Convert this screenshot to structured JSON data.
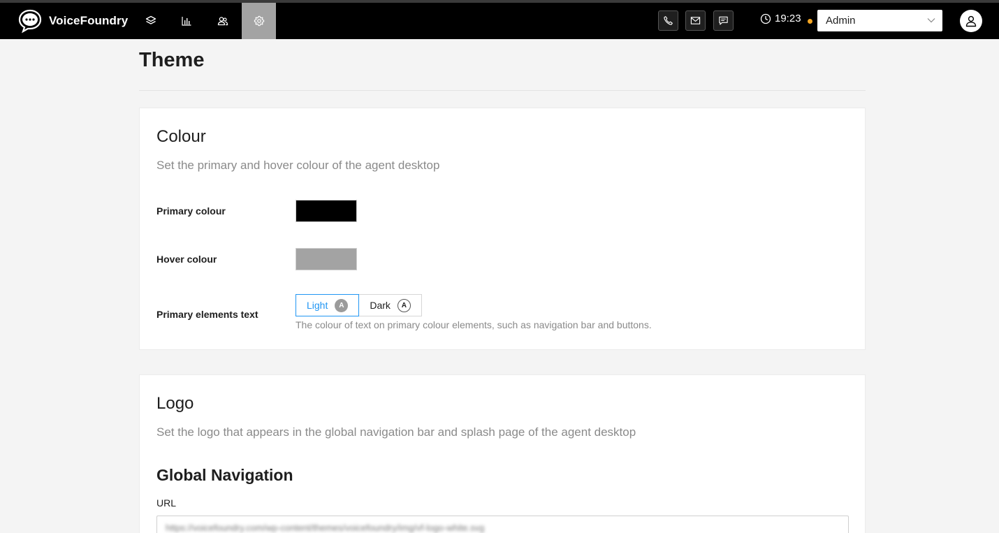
{
  "app": {
    "brand_name": "VoiceFoundry",
    "clock_time": "19:23",
    "user_select_value": "Admin",
    "status_color": "#f5a623",
    "accent_color": "#2196f3"
  },
  "nav": {
    "icons": [
      "layers-icon",
      "bar-chart-icon",
      "users-icon",
      "gear-icon"
    ],
    "active": "gear-icon",
    "tools": [
      "phone-icon",
      "mail-icon",
      "chat-icon"
    ]
  },
  "page": {
    "title": "Theme"
  },
  "colour_card": {
    "title": "Colour",
    "description": "Set the primary and hover colour of the agent desktop",
    "primary_label": "Primary colour",
    "primary_value": "#000000",
    "hover_label": "Hover colour",
    "hover_value": "#a3a3a3",
    "text_label": "Primary elements text",
    "light_label": "Light",
    "dark_label": "Dark",
    "badge_letter": "A",
    "selected_option": "Light",
    "hint": "The colour of text on primary colour elements, such as navigation bar and buttons."
  },
  "logo_card": {
    "title": "Logo",
    "description": "Set the logo that appears in the global navigation bar and splash page of the agent desktop",
    "section_title": "Global Navigation",
    "url_label": "URL",
    "url_value": "https://voicefoundry.com/wp-content/themes/voicefoundry/img/vf-logo-white.svg"
  }
}
